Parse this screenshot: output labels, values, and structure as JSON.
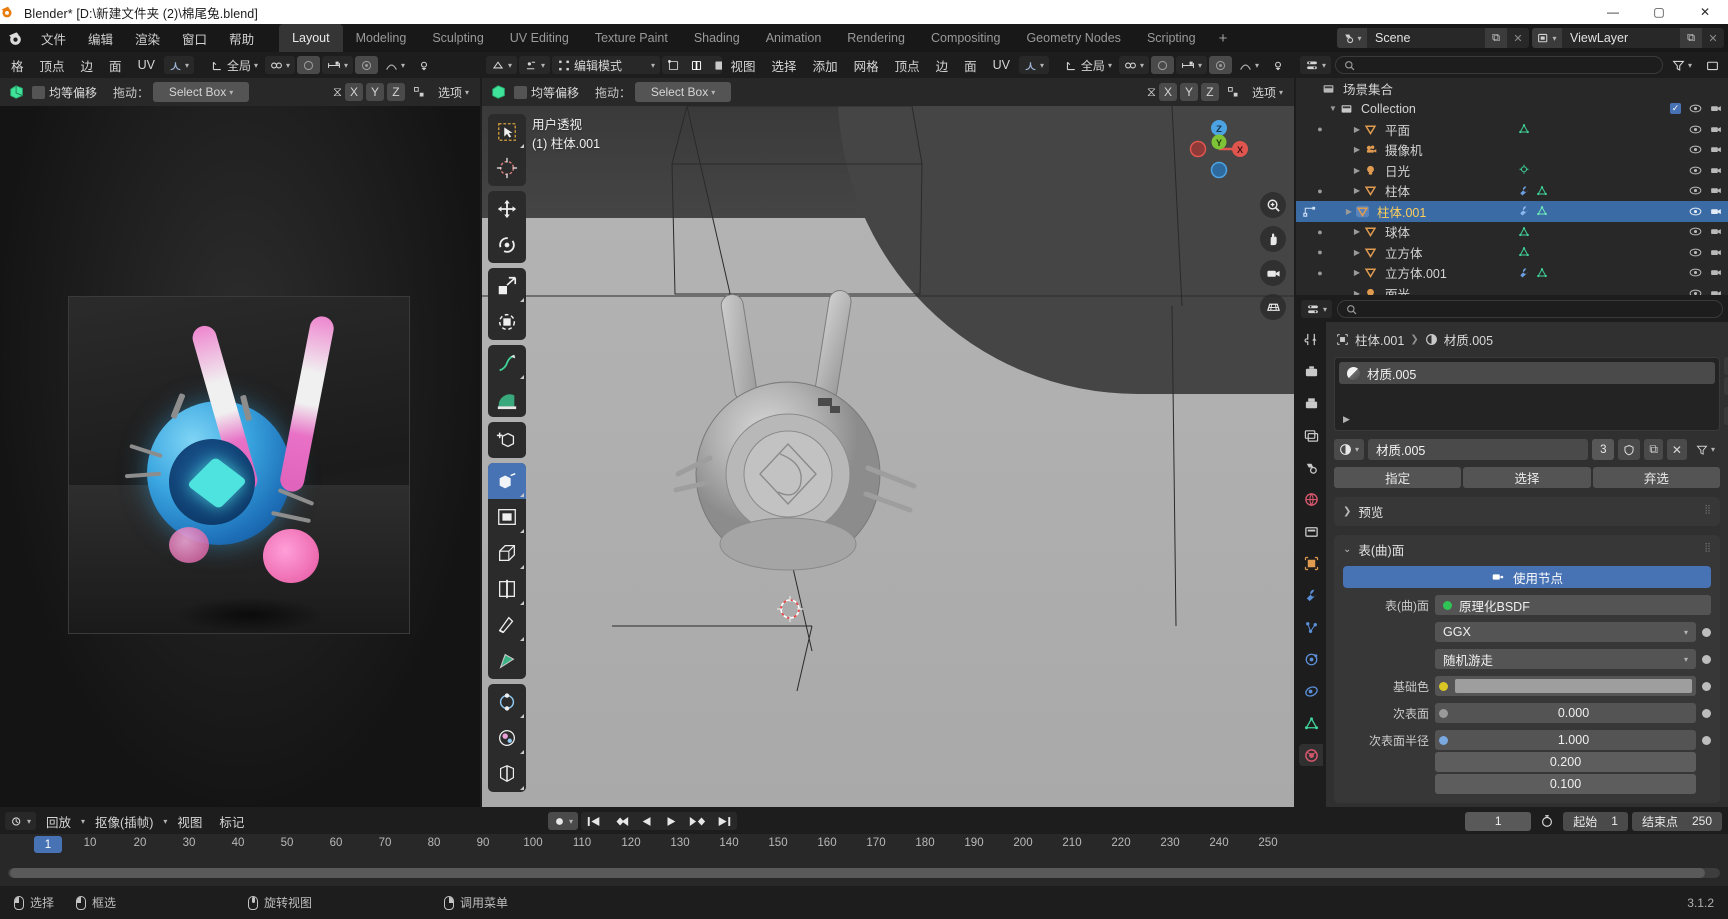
{
  "window": {
    "title": "Blender* [D:\\新建文件夹 (2)\\棉尾兔.blend]",
    "minimize": "—",
    "maximize": "▢",
    "close": "✕"
  },
  "topbar": {
    "menus": [
      "文件",
      "编辑",
      "渲染",
      "窗口",
      "帮助"
    ],
    "workspaces": [
      "Layout",
      "Modeling",
      "Sculpting",
      "UV Editing",
      "Texture Paint",
      "Shading",
      "Animation",
      "Rendering",
      "Compositing",
      "Geometry Nodes",
      "Scripting"
    ],
    "add_workspace": "+",
    "scene_name": "Scene",
    "viewlayer_name": "ViewLayer"
  },
  "left_editor": {
    "header_menus": [
      "格",
      "顶点",
      "边",
      "面",
      "UV"
    ],
    "transform_orientation": "全局",
    "tool_label": "均等偏移",
    "drag_label": "拖动：",
    "drag_value": "Select Box",
    "axis_x": "X",
    "axis_y": "Y",
    "axis_z": "Z",
    "options_label": "选项"
  },
  "viewport": {
    "mode": "编辑模式",
    "menus": [
      "视图",
      "选择",
      "添加",
      "网格",
      "顶点",
      "边",
      "面",
      "UV"
    ],
    "transform_orientation": "全局",
    "tool_label": "均等偏移",
    "drag_label": "拖动：",
    "drag_value": "Select Box",
    "axis_x": "X",
    "axis_y": "Y",
    "axis_z": "Z",
    "options_label": "选项",
    "overlay_line1": "用户透视",
    "overlay_line2": "(1) 柱体.001",
    "gizmo_axes": {
      "z": "Z",
      "y": "Y",
      "x": "X"
    },
    "tools": [
      {
        "name": "tweak-tool",
        "glyph": "select-box"
      },
      {
        "name": "cursor-tool",
        "glyph": "cursor"
      },
      {
        "name": "move-tool",
        "glyph": "move"
      },
      {
        "name": "rotate-tool",
        "glyph": "rotate"
      },
      {
        "name": "scale-tool",
        "glyph": "scale"
      },
      {
        "name": "transform-tool",
        "glyph": "transform"
      },
      {
        "name": "annotate-tool",
        "glyph": "annotate"
      },
      {
        "name": "measure-tool",
        "glyph": "measure"
      },
      {
        "name": "add-cube-tool",
        "glyph": "add-cube"
      },
      {
        "name": "extrude-region-tool",
        "glyph": "extrude"
      },
      {
        "name": "inset-faces-tool",
        "glyph": "inset"
      },
      {
        "name": "bevel-tool",
        "glyph": "bevel"
      },
      {
        "name": "loop-cut-tool",
        "glyph": "loopcut"
      },
      {
        "name": "knife-tool",
        "glyph": "knife"
      },
      {
        "name": "poly-build-tool",
        "glyph": "polybuild"
      },
      {
        "name": "spin-tool",
        "glyph": "spin"
      },
      {
        "name": "smooth-tool",
        "glyph": "smooth"
      },
      {
        "name": "edge-slide-tool",
        "glyph": "edgeslide"
      }
    ]
  },
  "outliner": {
    "display_mode": "view-layer",
    "search_placeholder": "",
    "root": "场景集合",
    "collection": "Collection",
    "items": [
      {
        "label": "平面",
        "icon": "mesh-data-icon",
        "selected": false,
        "has_dot": true,
        "modifier": false,
        "mesh_tri": true
      },
      {
        "label": "摄像机",
        "icon": "camera-data-icon",
        "selected": false,
        "has_dot": false,
        "modifier": false,
        "mesh_tri": false
      },
      {
        "label": "日光",
        "icon": "light-data-icon",
        "selected": false,
        "has_dot": false,
        "modifier": false,
        "mesh_tri": true
      },
      {
        "label": "柱体",
        "icon": "mesh-data-icon",
        "selected": false,
        "has_dot": true,
        "modifier": true,
        "mesh_tri": true
      },
      {
        "label": "柱体.001",
        "icon": "mesh-data-icon",
        "selected": true,
        "has_dot": false,
        "modifier": true,
        "mesh_tri": true
      },
      {
        "label": "球体",
        "icon": "mesh-data-icon",
        "selected": false,
        "has_dot": true,
        "modifier": false,
        "mesh_tri": true
      },
      {
        "label": "立方体",
        "icon": "mesh-data-icon",
        "selected": false,
        "has_dot": true,
        "modifier": false,
        "mesh_tri": true
      },
      {
        "label": "立方体.001",
        "icon": "mesh-data-icon",
        "selected": false,
        "has_dot": true,
        "modifier": true,
        "mesh_tri": true
      },
      {
        "label": "面光",
        "icon": "light-data-icon",
        "selected": false,
        "has_dot": false,
        "modifier": false,
        "mesh_tri": false
      }
    ]
  },
  "properties": {
    "breadcrumb_object": "柱体.001",
    "breadcrumb_material": "材质.005",
    "material_slot": "材质.005",
    "material_id": "材质.005",
    "material_users": "3",
    "buttons": [
      "指定",
      "选择",
      "弃选"
    ],
    "panel_preview": "预览",
    "panel_surface": "表(曲)面",
    "use_nodes": "使用节点",
    "surface_label": "表(曲)面",
    "surface_value": "原理化BSDF",
    "distribution": "GGX",
    "subsurface_method": "随机游走",
    "base_color_label": "基础色",
    "subsurface_label": "次表面",
    "subsurface_value": "0.000",
    "subsurface_radius_label": "次表面半径",
    "radius_x": "1.000",
    "radius_y": "0.200",
    "radius_z": "0.100",
    "tabs": [
      "tool-tab",
      "render-tab",
      "output-tab",
      "viewlayer-tab",
      "scene-tab",
      "world-tab",
      "collection-tab",
      "object-tab",
      "modifier-tab",
      "particles-tab",
      "physics-tab",
      "constraints-tab",
      "data-tab",
      "material-tab"
    ]
  },
  "timeline": {
    "editor_type": "timeline",
    "menus": [
      "回放",
      "抠像(插帧)",
      "视图",
      "标记"
    ],
    "playback_keying": "",
    "transport": [
      "jump-start",
      "prev-keyframe",
      "play-reverse",
      "play",
      "next-keyframe",
      "jump-end"
    ],
    "current_frame": "1",
    "start_label": "起始",
    "start_value": "1",
    "end_label": "结束点",
    "end_value": "250",
    "ticks": [
      "1",
      "10",
      "20",
      "30",
      "40",
      "50",
      "60",
      "70",
      "80",
      "90",
      "100",
      "110",
      "120",
      "130",
      "140",
      "150",
      "160",
      "170",
      "180",
      "190",
      "200",
      "210",
      "220",
      "230",
      "240",
      "250"
    ],
    "playhead_frame": "1"
  },
  "statusbar": {
    "items": [
      {
        "mouse": "left",
        "label": "选择"
      },
      {
        "mouse": "left-drag",
        "label": "框选"
      },
      {
        "mouse": "middle",
        "label": "旋转视图"
      },
      {
        "mouse": "right",
        "label": "调用菜单"
      }
    ],
    "version": "3.1.2"
  },
  "colors": {
    "accent_blue": "#4772b3",
    "select_orange": "#ffce5c",
    "mesh_orange": "#e09b50",
    "bg_dark": "#1d1d1d",
    "bg_mid": "#303030"
  }
}
